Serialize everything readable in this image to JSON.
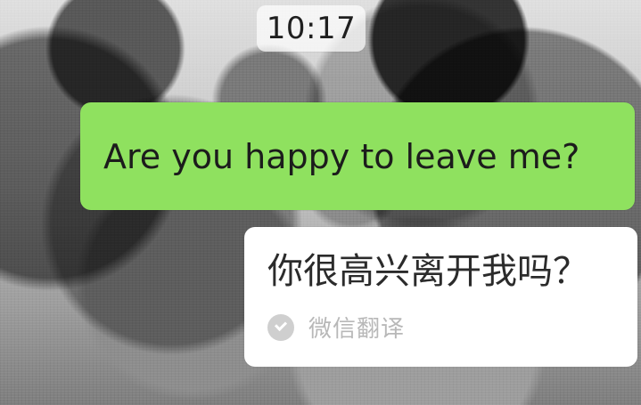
{
  "chat": {
    "timestamp": "10:17",
    "sent_message": "Are you happy to leave me?",
    "translation": {
      "text": "你很高兴离开我吗？",
      "source_label": "微信翻译",
      "icon": "check-circle-icon"
    }
  },
  "colors": {
    "sent_bubble": "#8fe15f",
    "translation_bubble": "#ffffff",
    "timestamp_pill": "rgba(255,255,255,0.70)"
  }
}
